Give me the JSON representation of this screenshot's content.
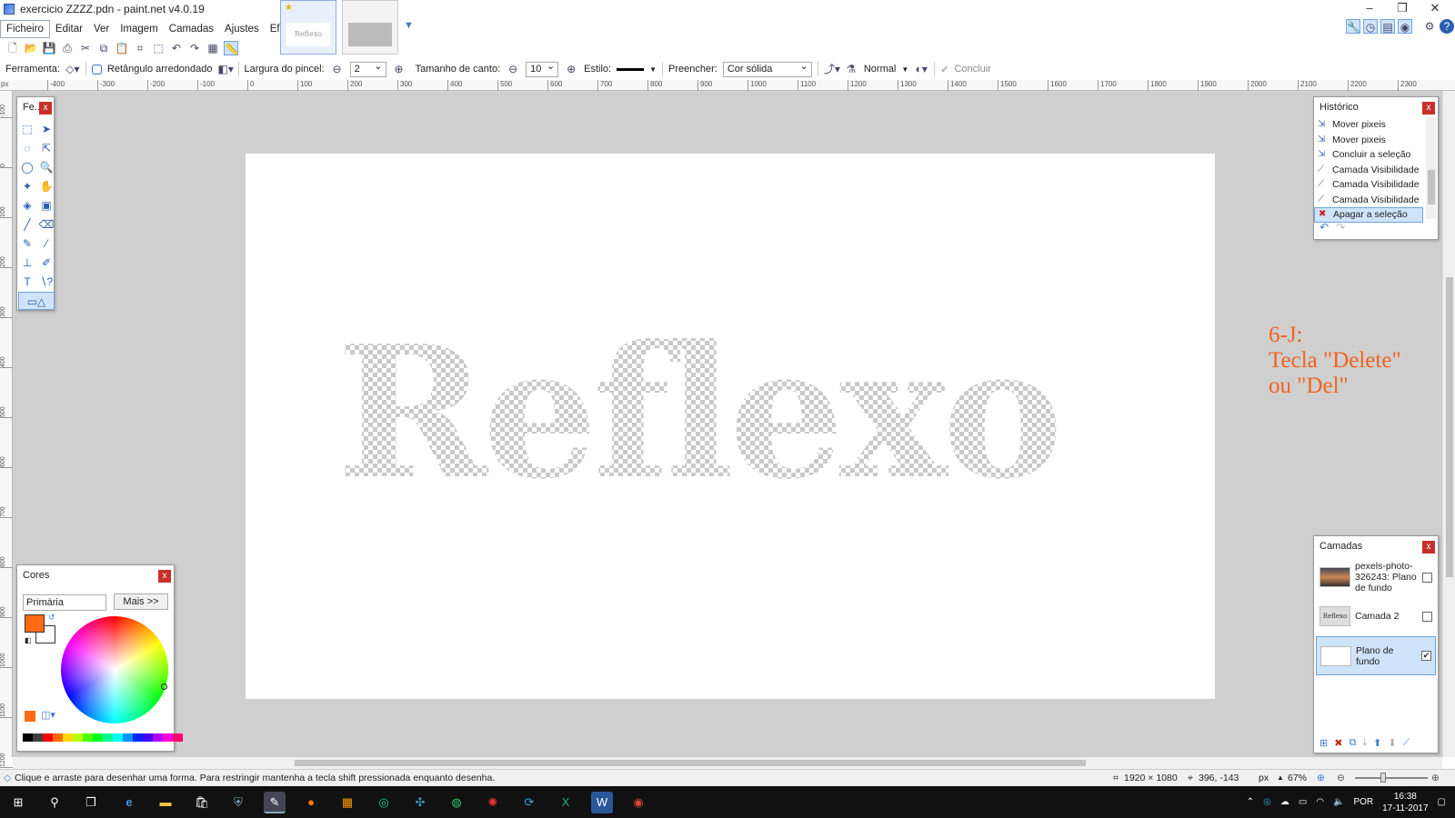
{
  "window": {
    "title": "exercicio ZZZZ.pdn - paint.net v4.0.19"
  },
  "menu": [
    "Ficheiro",
    "Editar",
    "Ver",
    "Imagem",
    "Camadas",
    "Ajustes",
    "Efeitos"
  ],
  "doc_thumb_text": "Reflexo",
  "tool_options": {
    "tool_label": "Ferramenta:",
    "shape": "Retângulo arredondado",
    "brush_width_label": "Largura do pincel:",
    "brush_width": "2",
    "corner_label": "Tamanho de canto:",
    "corner_size": "10",
    "style_label": "Estilo:",
    "fill_label": "Preencher:",
    "fill": "Cor sólida",
    "blend": "Normal",
    "finish": "Concluir"
  },
  "ruler_labels": [
    "-400",
    "-300",
    "-200",
    "-100",
    "0",
    "100",
    "200",
    "300",
    "400",
    "500",
    "600",
    "700",
    "800",
    "900",
    "1000",
    "1100",
    "1200",
    "1300",
    "1400",
    "1500",
    "1600",
    "1700",
    "1800",
    "1900",
    "2000",
    "2100",
    "2200",
    "2300"
  ],
  "canvas_text": "Reflexo",
  "annotation": [
    "6-J:",
    "Tecla \"Delete\"",
    "ou \"Del\""
  ],
  "tools_panel": {
    "title": "Fe...",
    "close": "x"
  },
  "history": {
    "title": "Histórico",
    "items": [
      "Mover pixeis",
      "Mover pixeis",
      "Concluir a seleção",
      "Camada Visibilidade",
      "Camada Visibilidade",
      "Camada Visibilidade",
      "Apagar a seleção"
    ]
  },
  "layers": {
    "title": "Camadas",
    "items": [
      {
        "name": "pexels-photo-326243: Plano de fundo",
        "visible": false
      },
      {
        "name": "Camada 2",
        "visible": false
      },
      {
        "name": "Plano de fundo",
        "visible": true
      }
    ]
  },
  "colors": {
    "title": "Cores",
    "mode": "Primária",
    "more": "Mais >>",
    "primary": "#ff6a13",
    "secondary": "#ffffff"
  },
  "status": {
    "hint": "Clique e arraste para desenhar uma forma. Para restringir mantenha a tecla shift pressionada enquanto desenha.",
    "image_size": "1920 × 1080",
    "cursor": "396, -143",
    "units": "px",
    "zoom": "67%"
  },
  "taskbar": {
    "lang": "POR",
    "time": "16:38",
    "date": "17-11-2017"
  }
}
